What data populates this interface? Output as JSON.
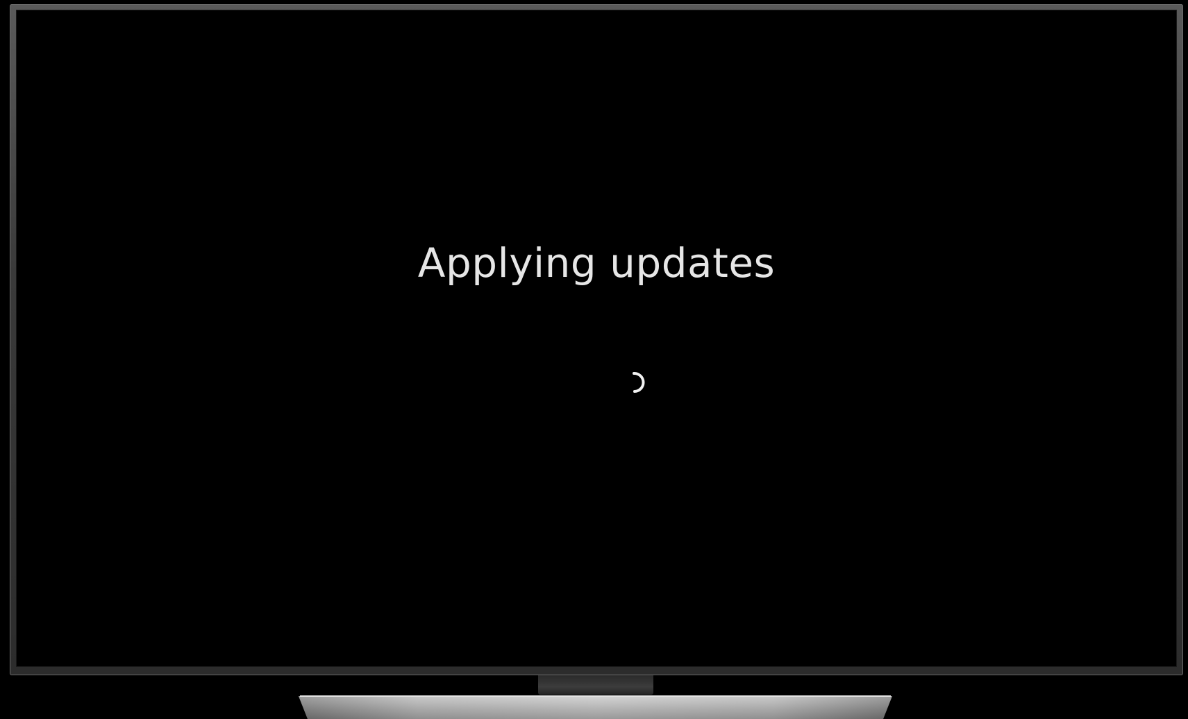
{
  "screen": {
    "message": "Applying updates",
    "spinner_icon": "loading-spinner-icon"
  },
  "colors": {
    "background": "#000000",
    "text": "#e6e6e6",
    "bezel": "#3a3a3a",
    "stand": "#b5b5b5"
  }
}
